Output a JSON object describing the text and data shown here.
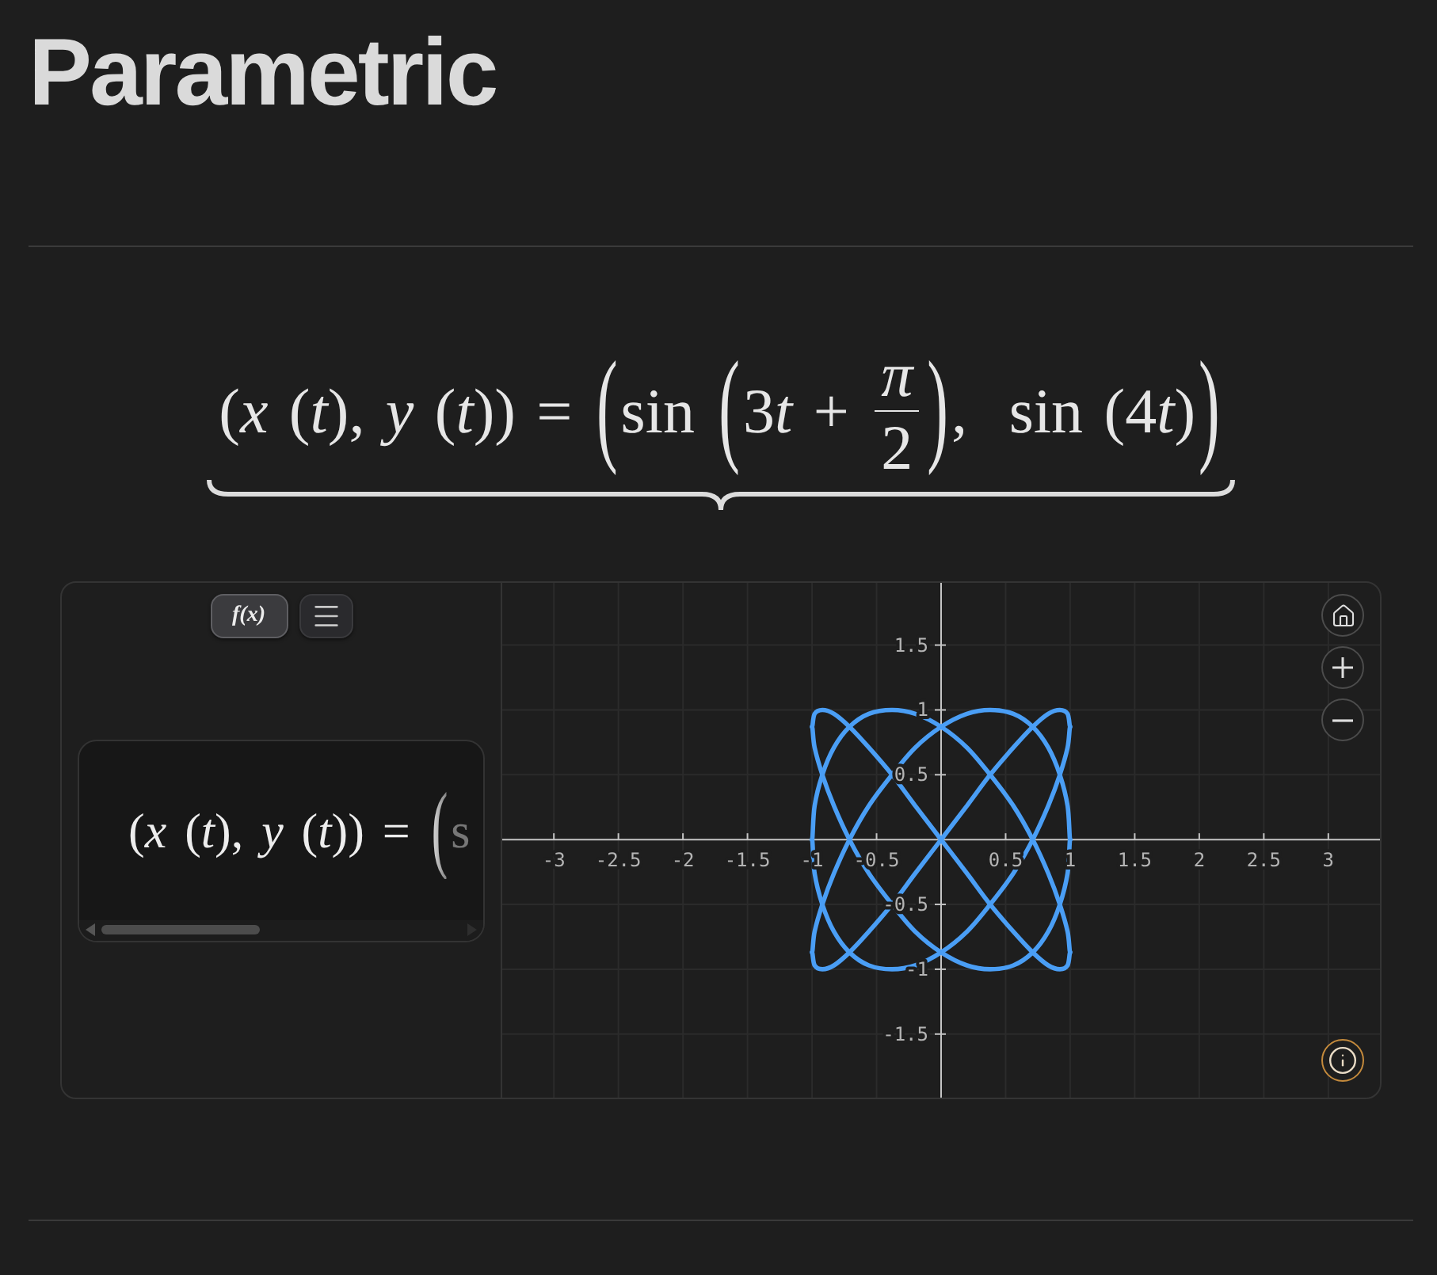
{
  "title": "Parametric",
  "equation": [
    {
      "kind": "text",
      "text": "(*x* (*t*), *y* (*t*)) = "
    },
    {
      "kind": "paren",
      "text": "("
    },
    {
      "kind": "text",
      "text": "sin "
    },
    {
      "kind": "paren",
      "text": "("
    },
    {
      "kind": "text",
      "text": "3"
    },
    {
      "kind": "text",
      "text": "*t* + "
    },
    {
      "kind": "fraction",
      "numerator": "π",
      "denominator": "2"
    },
    {
      "kind": "paren",
      "text": ")"
    },
    {
      "kind": "text",
      "text": ",  sin (4"
    },
    {
      "kind": "text",
      "text": "*t*)"
    },
    {
      "kind": "paren",
      "text": ")"
    }
  ],
  "graph": {
    "toolbar": [
      {
        "kind": "text",
        "text": "f(x)",
        "selected": true
      },
      {
        "kind": "menu",
        "selected": false
      }
    ],
    "expression": [
      {
        "kind": "text",
        "text": "(*x* (*t*), *y* (*t*)) = "
      },
      {
        "kind": "paren",
        "text": "("
      },
      {
        "kind": "text",
        "text": "s"
      }
    ],
    "chart_data": {
      "type": "line",
      "grid": true,
      "xlim": [
        -3.4,
        3.4
      ],
      "ylim": [
        -1.99,
        1.98
      ],
      "xticks": [
        {
          "value": -3,
          "label": "-3"
        },
        {
          "value": -2.5,
          "label": "-2.5"
        },
        {
          "value": -2,
          "label": "-2"
        },
        {
          "value": -1.5,
          "label": "-1.5"
        },
        {
          "value": -1,
          "label": "-1"
        },
        {
          "value": -0.5,
          "label": "-0.5"
        },
        {
          "value": 0.5,
          "label": "0.5"
        },
        {
          "value": 1,
          "label": "1"
        },
        {
          "value": 1.5,
          "label": "1.5"
        },
        {
          "value": 2,
          "label": "2"
        },
        {
          "value": 2.5,
          "label": "2.5"
        },
        {
          "value": 3,
          "label": "3"
        }
      ],
      "yticks": [
        {
          "value": 1.5,
          "label": "1.5"
        },
        {
          "value": 1,
          "label": "1"
        },
        {
          "value": 0.5,
          "label": "0.5"
        },
        {
          "value": -0.5,
          "label": "-0.5"
        },
        {
          "value": -1,
          "label": "-1"
        },
        {
          "value": -1.5,
          "label": "-1.5"
        }
      ],
      "x": [
        -1,
        -0.98,
        -0.92,
        -0.83,
        -0.71,
        -0.56,
        -0.38,
        -0.2,
        0,
        0.2,
        0.38,
        0.56,
        0.71,
        0.83,
        0.92,
        0.98,
        1
      ],
      "series": [
        {
          "color": "#4a9ef5",
          "values": [
            -0.87,
            -0.71,
            -0.5,
            -0.26,
            0,
            0.26,
            0.5,
            0.71,
            0.87,
            0.97,
            1,
            0.97,
            0.87,
            0.71,
            0.5,
            0.26,
            0
          ]
        },
        {
          "color": "#4a9ef5",
          "values": [
            -0.87,
            -0.97,
            -1,
            -0.97,
            -0.87,
            -0.71,
            -0.5,
            -0.26,
            0,
            0.26,
            0.5,
            0.71,
            0.87,
            0.97,
            1,
            0.97,
            0.87
          ]
        },
        {
          "color": "#4a9ef5",
          "values": [
            0,
            -0.26,
            -0.5,
            -0.71,
            -0.87,
            -0.97,
            -1,
            -0.97,
            -0.87,
            -0.71,
            -0.5,
            -0.26,
            0,
            0.26,
            0.5,
            0.71,
            0.87
          ]
        },
        {
          "color": "#4a9ef5",
          "values": [
            0,
            0.26,
            0.5,
            0.71,
            0.87,
            0.97,
            1,
            0.97,
            0.87,
            0.71,
            0.5,
            0.26,
            0,
            -0.26,
            -0.5,
            -0.71,
            -0.87
          ]
        },
        {
          "color": "#4a9ef5",
          "values": [
            0.87,
            0.97,
            1,
            0.97,
            0.87,
            0.71,
            0.5,
            0.26,
            0,
            -0.26,
            -0.5,
            -0.71,
            -0.87,
            -0.97,
            -1,
            -0.97,
            -0.87
          ]
        },
        {
          "color": "#4a9ef5",
          "values": [
            0.87,
            0.71,
            0.5,
            0.26,
            0,
            -0.26,
            -0.5,
            -0.71,
            -0.87,
            -0.97,
            -1,
            -0.97,
            -0.87,
            -0.71,
            -0.5,
            -0.26,
            0
          ]
        }
      ]
    }
  }
}
